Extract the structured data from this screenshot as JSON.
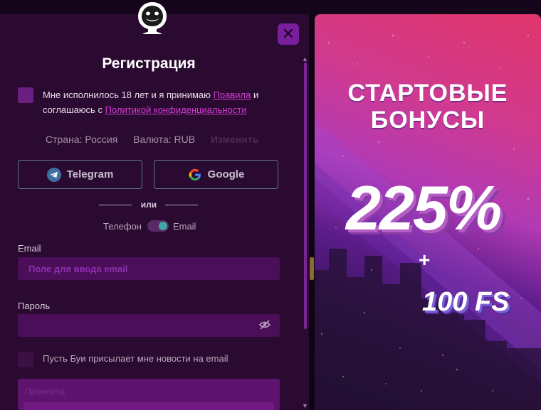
{
  "modal": {
    "title": "Регистрация",
    "close_icon": "close-icon",
    "logo_icon": "gorilla-logo-icon"
  },
  "agree": {
    "checked": false,
    "text_before": "Мне исполнилось 18 лет и я принимаю",
    "rules_link": "Правила",
    "text_middle": "и соглашаюсь с",
    "privacy_link": "Политикой конфиденциальности"
  },
  "locale": {
    "country": "Страна: Россия",
    "currency": "Валюта: RUB",
    "change_label": "Изменить"
  },
  "social": {
    "telegram_label": "Telegram",
    "google_label": "Google"
  },
  "divider": {
    "or_label": "или"
  },
  "method_toggle": {
    "left_label": "Телефон",
    "right_label": "Email",
    "selected": "Email"
  },
  "email": {
    "label": "Email",
    "placeholder": "Поле для ввода email",
    "value": ""
  },
  "password": {
    "label": "Пароль",
    "value": "",
    "toggle_icon": "eye-slash-icon"
  },
  "newsletter": {
    "checked": false,
    "label": "Пусть Буи присылает мне новости на email"
  },
  "promo_code": {
    "label": "Промокод"
  },
  "bonus": {
    "title_line1": "СТАРТОВЫЕ",
    "title_line2": "БОНУСЫ",
    "percent": "225%",
    "plus": "+",
    "free_spins": "100 FS"
  },
  "colors": {
    "accent": "#d63cd6",
    "panel_bg": "#2a0a30",
    "input_bg": "#4a0f58",
    "close_bg": "#7a1f9c"
  }
}
